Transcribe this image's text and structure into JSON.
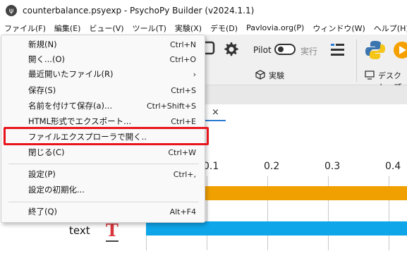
{
  "window": {
    "title": "counterbalance.psyexp - PsychoPy Builder (v2024.1.1)"
  },
  "menubar": [
    "ファイル(F)",
    "編集(E)",
    "ビュー(V)",
    "ツール(T)",
    "実験(X)",
    "デモ(D)",
    "Pavlovia.org(P)",
    "ウィンドウ(W)",
    "ヘルプ(H)"
  ],
  "toolbar": {
    "pilot_label": "Pilot",
    "run_label": "実行",
    "experiment_section": "実験",
    "desktop_section": "デスクトップ"
  },
  "file_menu": {
    "items": [
      {
        "label": "新規(N)",
        "shortcut": "Ctrl+N"
      },
      {
        "label": "開く...(O)",
        "shortcut": "Ctrl+O"
      },
      {
        "label": "最近開いたファイル(R)",
        "shortcut": "›"
      },
      {
        "label": "保存(S)",
        "shortcut": "Ctrl+S"
      },
      {
        "label": "名前を付けて保存(a)...",
        "shortcut": "Ctrl+Shift+S"
      },
      {
        "label": "HTML形式でエクスポート...",
        "shortcut": "Ctrl+E"
      },
      {
        "label": "ファイルエクスプローラで開く..",
        "shortcut": ""
      },
      {
        "label": "閉じる(C)",
        "shortcut": "Ctrl+W"
      },
      {
        "label": "設定(P)",
        "shortcut": "Ctrl+,"
      },
      {
        "label": "設定の初期化...",
        "shortcut": ""
      },
      {
        "label": "終了(Q)",
        "shortcut": "Alt+F4"
      }
    ]
  },
  "routine": {
    "tab_close": "×",
    "ticks": [
      "0.1",
      "0.2",
      "0.3",
      "0.4"
    ],
    "component_label": "text",
    "component_icon": "T"
  },
  "colors": {
    "bar_orange": "#f0a000",
    "bar_blue": "#0ea5e9",
    "highlight": "#e8141c"
  }
}
